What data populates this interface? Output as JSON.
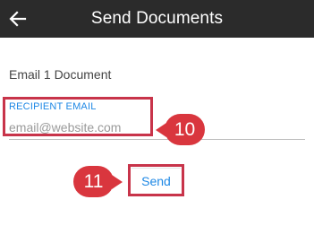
{
  "header": {
    "title": "Send Documents",
    "back_icon": "arrow-left-icon"
  },
  "content": {
    "subtitle": "Email 1 Document",
    "recipient_label": "RECIPIENT EMAIL",
    "recipient_placeholder": "email@website.com",
    "send_label": "Send"
  },
  "callouts": {
    "email": "10",
    "send": "11"
  },
  "colors": {
    "appbar": "#2b2b2b",
    "accent": "#1e88e5",
    "callout": "#d9363e",
    "highlight": "#c8344a"
  }
}
